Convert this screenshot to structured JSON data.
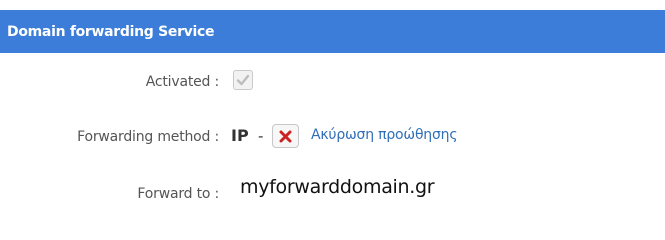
{
  "header": {
    "title": "Domain forwarding Service",
    "background": "#3b7dd8"
  },
  "rows": {
    "activated": {
      "label": "Activated :",
      "checked": true
    },
    "method": {
      "label": "Forwarding method :",
      "value": "IP",
      "separator": "-",
      "cancel_icon": "x-icon",
      "cancel_link": "Ακύρωση προώθησης"
    },
    "forward_to": {
      "label": "Forward to :",
      "value": "myforwarddomain.gr"
    }
  },
  "colors": {
    "link": "#2f6fb8",
    "cancel_icon": "#cc2222"
  }
}
